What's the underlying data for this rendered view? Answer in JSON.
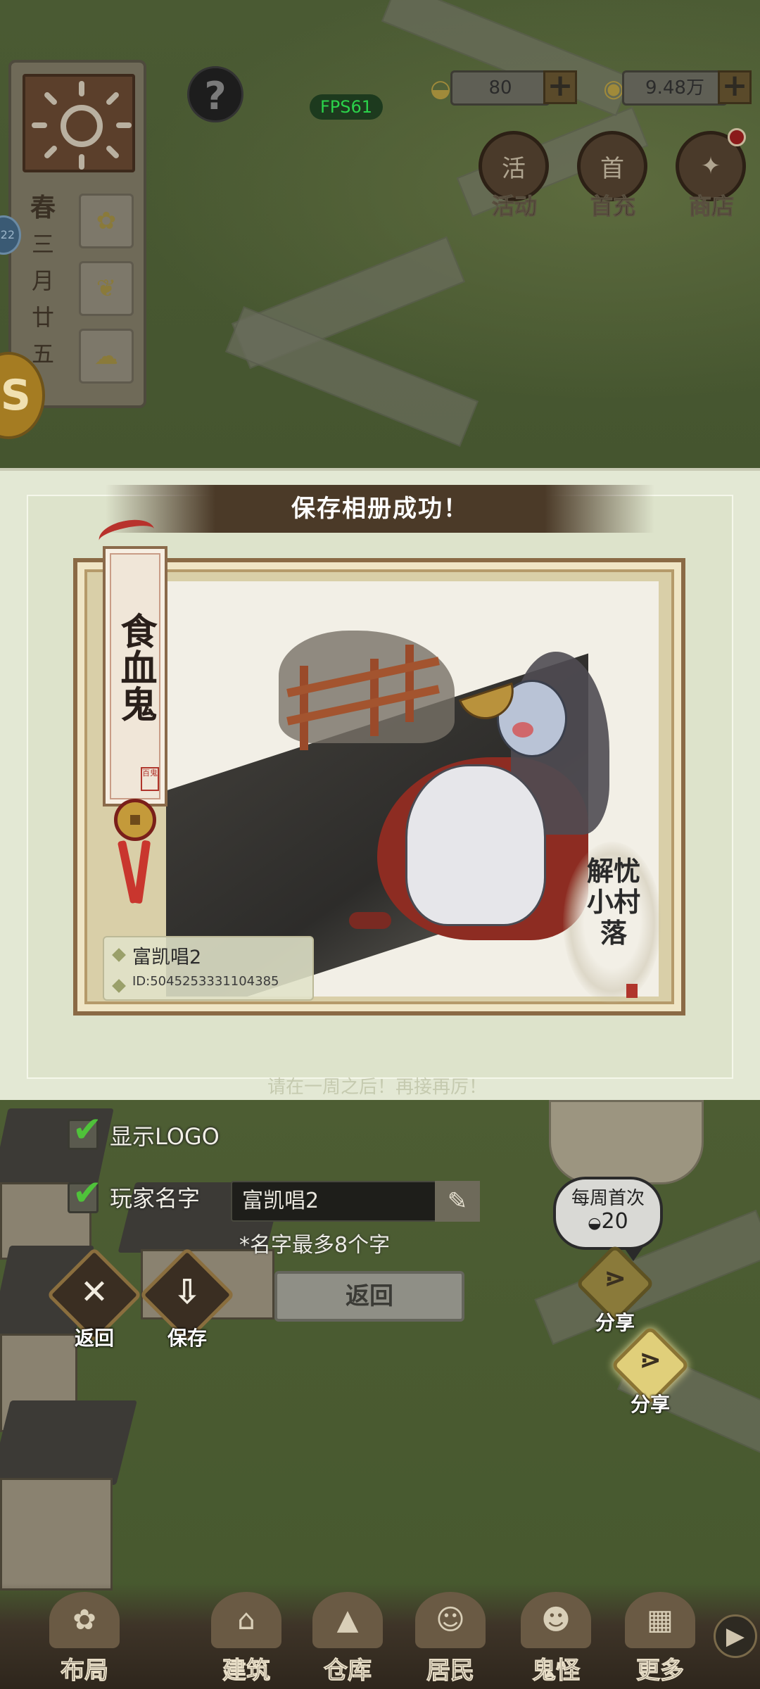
{
  "hud": {
    "fps": "FPS61",
    "silver": "80",
    "copper": "9.48万",
    "calendar": {
      "season": "春",
      "date_lines": [
        "三",
        "月",
        "廿",
        "五"
      ]
    },
    "side_badge": "22",
    "top_buttons": [
      {
        "label": "活动",
        "icon": "scroll-icon",
        "glyph": "活"
      },
      {
        "label": "首充",
        "icon": "money-bag-icon",
        "glyph": "首"
      },
      {
        "label": "商店",
        "icon": "shop-icon",
        "glyph": "",
        "has_notification": true
      }
    ]
  },
  "share_panel": {
    "title": "保存相册成功！",
    "character_name": "食血鬼",
    "seal_text": "百鬼",
    "player_name": "富凯唱2",
    "player_id": "ID:5045253331104385",
    "logo_text": "解忧小村落",
    "hint_text": "请在一周之后！再接再厉！"
  },
  "options": {
    "show_logo_label": "显示LOGO",
    "player_name_label": "玩家名字",
    "name_value": "富凯唱2",
    "name_hint": "*名字最多8个字",
    "show_logo_checked": true,
    "player_name_checked": true
  },
  "actions": {
    "return_label": "返回",
    "save_label": "保存",
    "back_button": "返回",
    "weekly_title": "每周首次",
    "weekly_reward": "20",
    "share_label_1": "分享",
    "share_label_2": "分享"
  },
  "bottom_nav": [
    {
      "label": "布局"
    },
    {
      "label": "建筑"
    },
    {
      "label": "仓库"
    },
    {
      "label": "居民"
    },
    {
      "label": "鬼怪"
    },
    {
      "label": "更多"
    }
  ],
  "colors": {
    "panel_bg": "#e3e8d4",
    "title_band": "#4b3a28",
    "check": "#4fc23a",
    "fps_text": "#2bd24a"
  }
}
